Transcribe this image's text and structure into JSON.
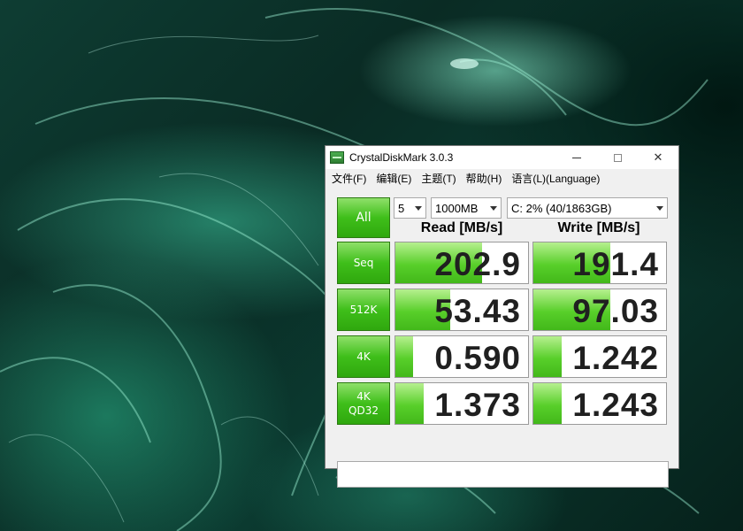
{
  "window": {
    "title": "CrystalDiskMark 3.0.3",
    "icon": "crystaldiskmark-icon"
  },
  "menu": [
    "文件(F)",
    "编辑(E)",
    "主题(T)",
    "帮助(H)",
    "语言(L)(Language)"
  ],
  "controls": {
    "all_label": "All",
    "count": "5",
    "size": "1000MB",
    "drive": "C: 2% (40/1863GB)"
  },
  "headers": {
    "read": "Read [MB/s]",
    "write": "Write [MB/s]"
  },
  "rows": [
    {
      "label_line1": "Seq",
      "label_line2": "",
      "read": "202.9",
      "write": "191.4",
      "read_fill": 0.65,
      "write_fill": 0.58
    },
    {
      "label_line1": "512K",
      "label_line2": "",
      "read": "53.43",
      "write": "97.03",
      "read_fill": 0.41,
      "write_fill": 0.58
    },
    {
      "label_line1": "4K",
      "label_line2": "",
      "read": "0.590",
      "write": "1.242",
      "read_fill": 0.13,
      "write_fill": 0.21
    },
    {
      "label_line1": "4K",
      "label_line2": "QD32",
      "read": "1.373",
      "write": "1.243",
      "read_fill": 0.21,
      "write_fill": 0.21
    }
  ],
  "colors": {
    "accent_green": "#3fbf1a",
    "bar_green": "#58cf2a",
    "wallpaper": "#0e3d33"
  }
}
